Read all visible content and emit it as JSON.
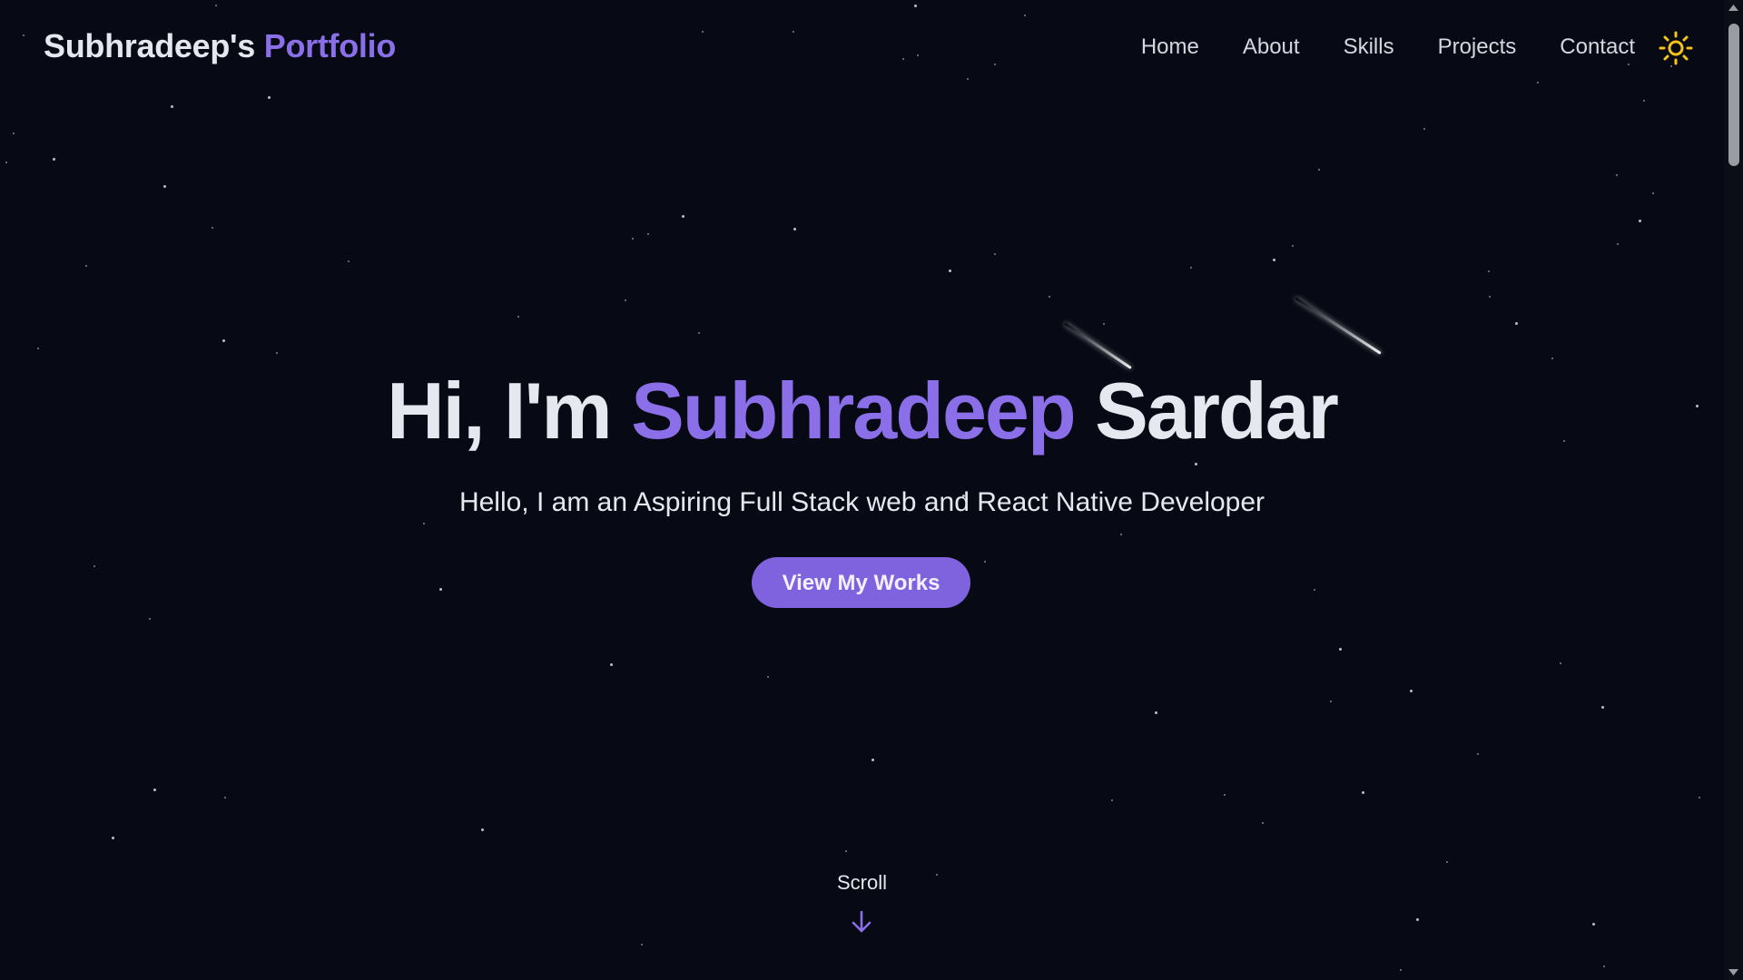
{
  "navbar": {
    "brand_prefix": "Subhradeep's",
    "brand_accent": "Portfolio",
    "links": [
      {
        "label": "Home"
      },
      {
        "label": "About"
      },
      {
        "label": "Skills"
      },
      {
        "label": "Projects"
      },
      {
        "label": "Contact"
      }
    ],
    "theme_toggle_icon": "sun-icon"
  },
  "hero": {
    "greeting": "Hi, I'm",
    "first_name": "Subhradeep",
    "last_name": "Sardar",
    "subtitle": "Hello, I am an Aspiring Full Stack web and React Native Developer",
    "cta_label": "View My Works"
  },
  "scroll": {
    "label": "Scroll",
    "icon": "arrow-down-icon"
  },
  "colors": {
    "background": "#070a14",
    "accent": "#8b6fe8",
    "button": "#7f63de",
    "sun": "#f5c518",
    "text": "#e6e8f0"
  }
}
